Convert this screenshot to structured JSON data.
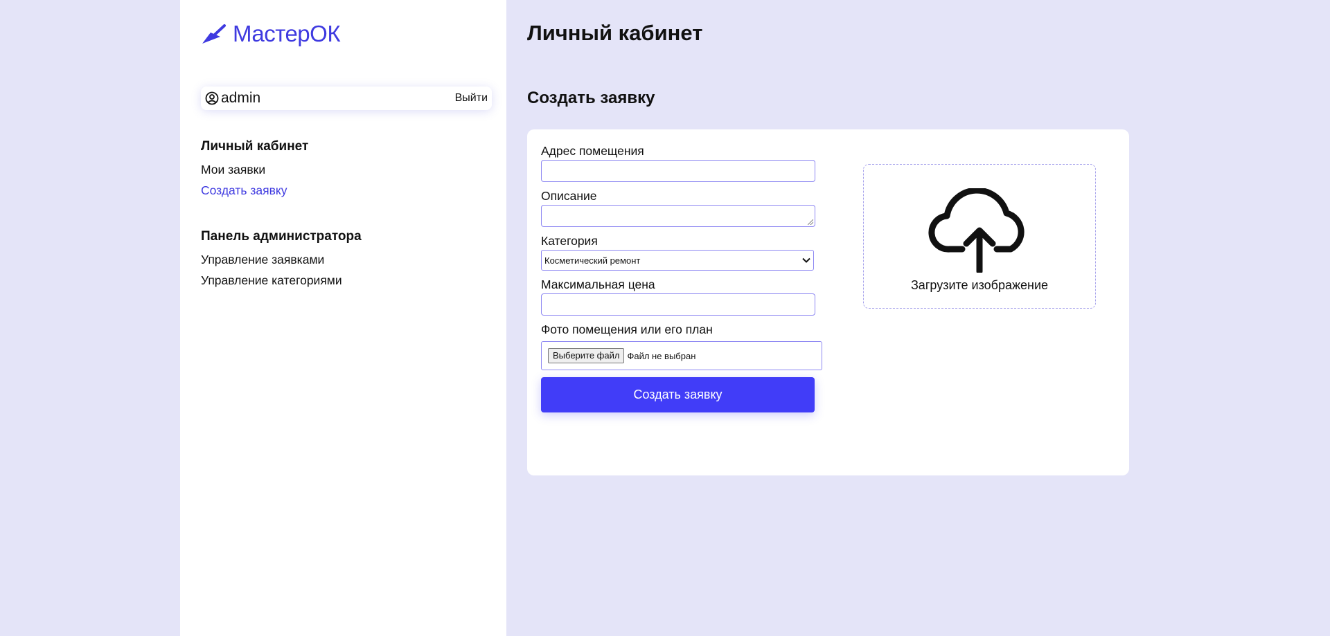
{
  "brand": {
    "name": "МастерОК",
    "color": "#3f3ae0"
  },
  "user": {
    "name": "admin",
    "logout_label": "Выйти"
  },
  "sidebar": {
    "sections": [
      {
        "heading": "Личный кабинет",
        "items": [
          {
            "label": "Мои заявки",
            "active": false
          },
          {
            "label": "Создать заявку",
            "active": true
          }
        ]
      },
      {
        "heading": "Панель администратора",
        "items": [
          {
            "label": "Управление заявками",
            "active": false
          },
          {
            "label": "Управление категориями",
            "active": false
          }
        ]
      }
    ]
  },
  "main": {
    "page_title": "Личный кабинет",
    "section_title": "Создать заявку"
  },
  "form": {
    "address": {
      "label": "Адрес помещения",
      "value": ""
    },
    "description": {
      "label": "Описание",
      "value": ""
    },
    "category": {
      "label": "Категория",
      "selected": "Косметический ремонт"
    },
    "max_price": {
      "label": "Максимальная цена",
      "value": ""
    },
    "photo": {
      "label": "Фото помещения или его план",
      "button_label": "Выберите файл",
      "status": "Файл не выбран"
    },
    "submit_label": "Создать заявку"
  },
  "upload": {
    "label": "Загрузите изображение",
    "icon": "cloud-upload-icon"
  },
  "colors": {
    "background": "#e4e4f8",
    "accent": "#413df8",
    "input_border": "#8c86f2"
  }
}
